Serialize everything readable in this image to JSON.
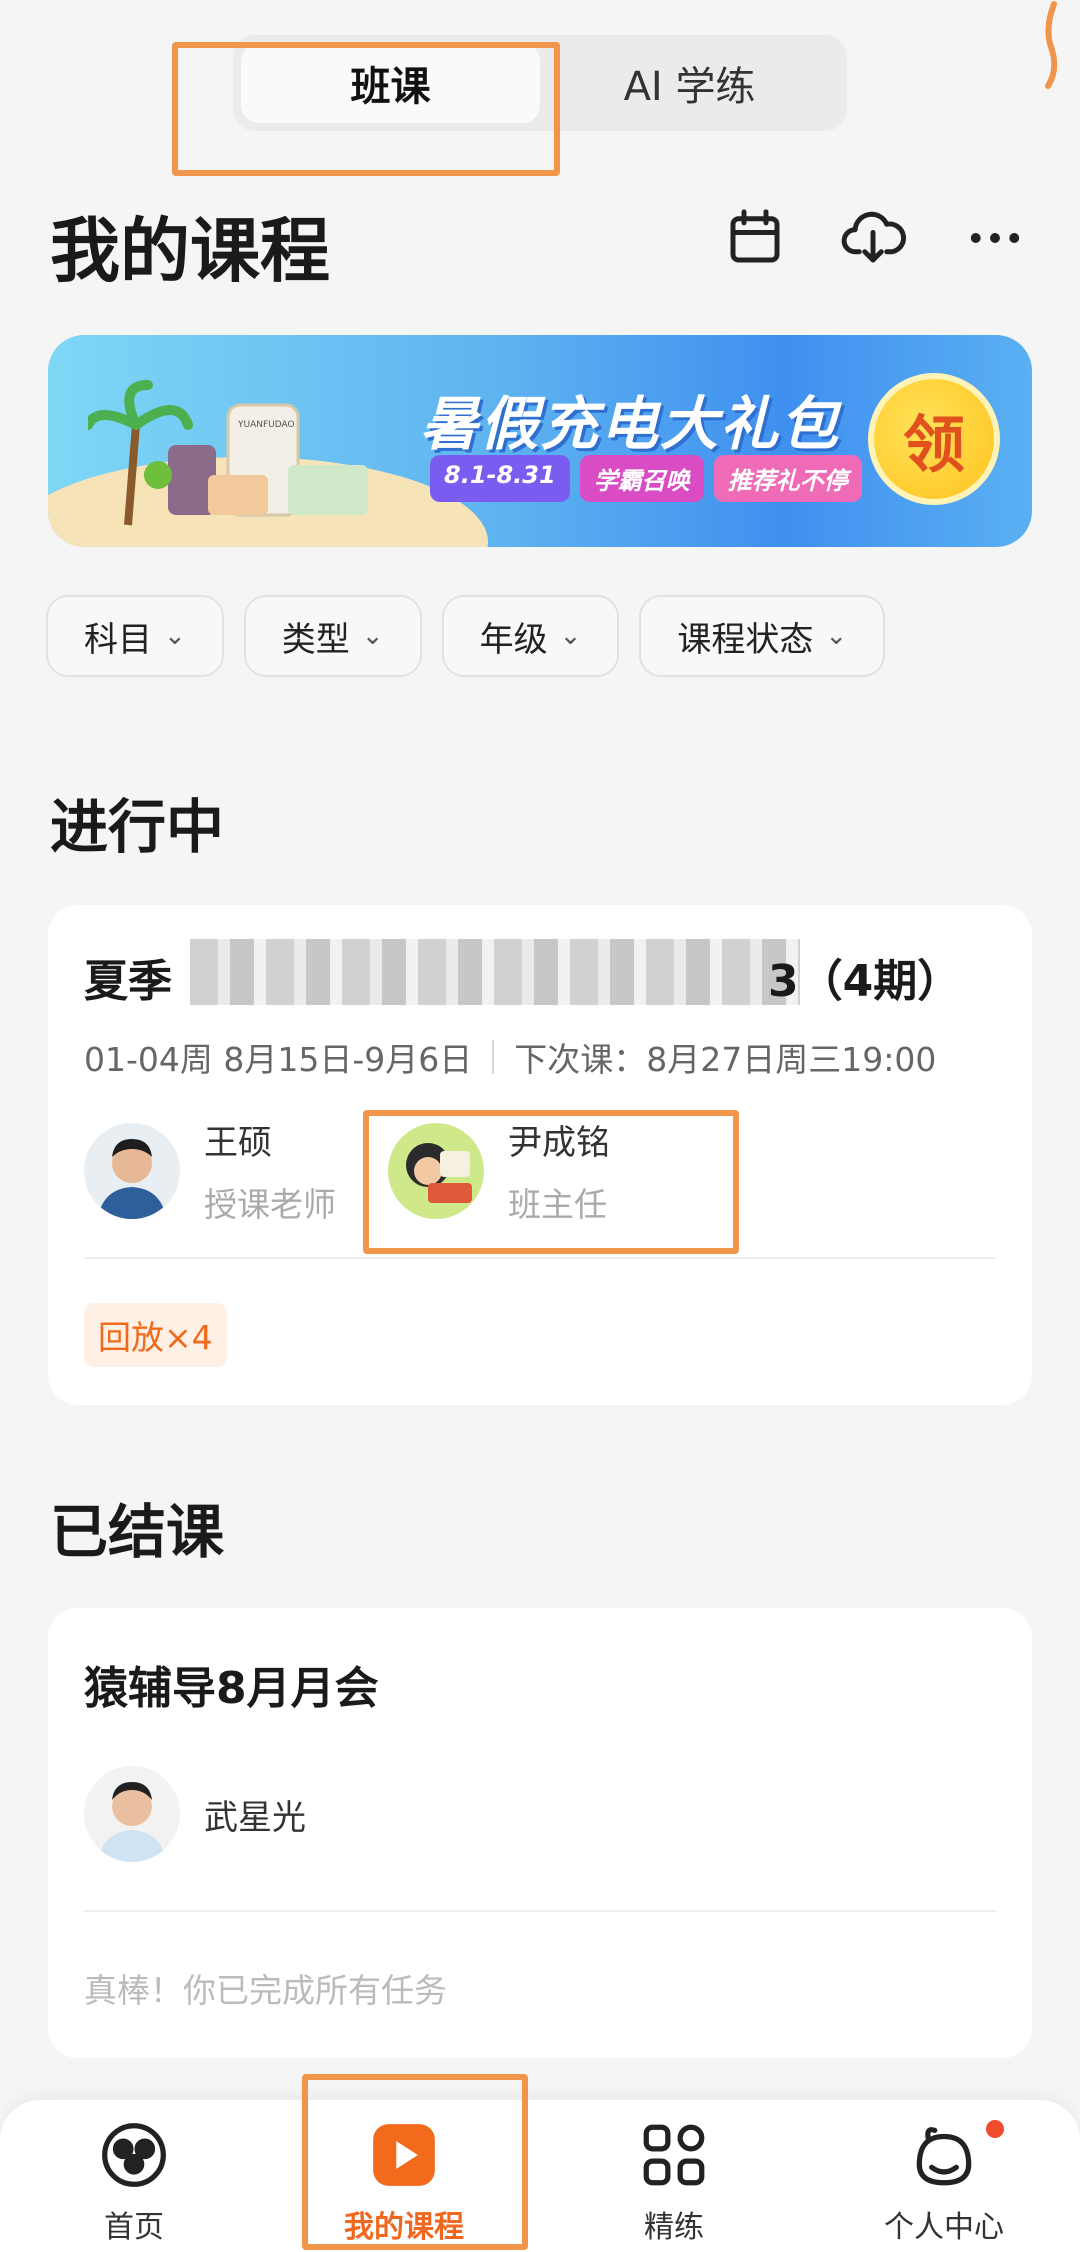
{
  "top_tabs": [
    {
      "label": "班课",
      "active": true
    },
    {
      "label": "AI 学练",
      "active": false
    }
  ],
  "header": {
    "title": "我的课程",
    "icons": [
      "calendar-icon",
      "cloud-download-icon",
      "more-icon"
    ]
  },
  "banner": {
    "headline": "暑假充电大礼包",
    "tags": [
      "8.1-8.31",
      "学霸召唤",
      "推荐礼不停"
    ],
    "claim_label": "领",
    "product_brand": "YUANFUDAO"
  },
  "filters": [
    {
      "label": "科目"
    },
    {
      "label": "类型"
    },
    {
      "label": "年级"
    },
    {
      "label": "课程状态"
    }
  ],
  "in_progress": {
    "section_title": "进行中",
    "course": {
      "title_visible_prefix": "夏季",
      "title_visible_suffix": "3（4期）",
      "weeks": "01-04周 8月15日-9月6日",
      "next_class": "下次课：8月27日周三19:00",
      "teachers": [
        {
          "name": "王硕",
          "role": "授课老师"
        },
        {
          "name": "尹成铭",
          "role": "班主任"
        }
      ],
      "badge": "回放×4"
    }
  },
  "finished": {
    "section_title": "已结课",
    "course": {
      "title": "猿辅导8月月会",
      "teacher": "武星光",
      "completion": "真棒！你已完成所有任务"
    }
  },
  "bottom_nav": [
    {
      "label": "首页",
      "icon": "home-icon",
      "active": false
    },
    {
      "label": "我的课程",
      "icon": "my-courses-icon",
      "active": true
    },
    {
      "label": "精练",
      "icon": "practice-icon",
      "active": false
    },
    {
      "label": "个人中心",
      "icon": "profile-icon",
      "active": false
    }
  ],
  "colors": {
    "accent": "#f0681f",
    "annotation": "#f0954a",
    "badge_bg": "#fff0e6"
  }
}
